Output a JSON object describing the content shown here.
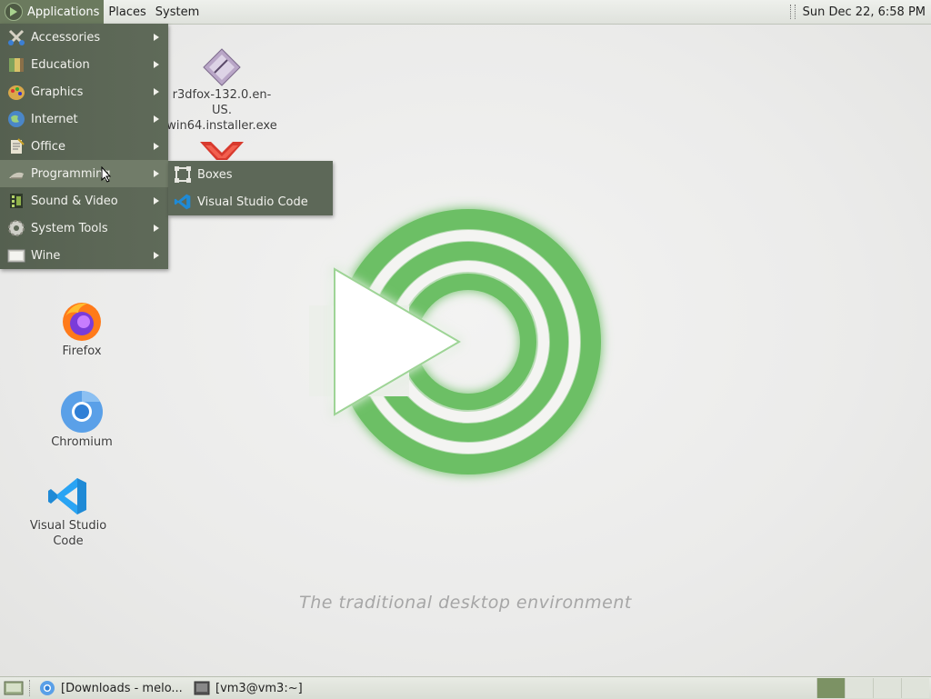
{
  "top_panel": {
    "menus": [
      "Applications",
      "Places",
      "System"
    ],
    "clock": "Sun Dec 22,  6:58 PM"
  },
  "apps_menu": {
    "items": [
      {
        "label": "Accessories",
        "icon": "accessories-icon"
      },
      {
        "label": "Education",
        "icon": "education-icon"
      },
      {
        "label": "Graphics",
        "icon": "graphics-icon"
      },
      {
        "label": "Internet",
        "icon": "internet-icon"
      },
      {
        "label": "Office",
        "icon": "office-icon"
      },
      {
        "label": "Programming",
        "icon": "programming-icon",
        "selected": true
      },
      {
        "label": "Sound & Video",
        "icon": "sound-video-icon"
      },
      {
        "label": "System Tools",
        "icon": "system-tools-icon"
      },
      {
        "label": "Wine",
        "icon": "wine-icon"
      }
    ]
  },
  "programming_submenu": {
    "items": [
      {
        "label": "Boxes",
        "icon": "boxes-icon"
      },
      {
        "label": "Visual Studio Code",
        "icon": "vscode-icon"
      }
    ]
  },
  "desktop": {
    "icons": [
      {
        "label_line1": "r3dfox-132.0.en-US.",
        "label_line2": "win64.installer.exe",
        "icon": "installer-icon"
      },
      {
        "label": "Firefox",
        "icon": "firefox-icon"
      },
      {
        "label": "Chromium",
        "icon": "chromium-icon"
      },
      {
        "label": "Visual Studio Code",
        "icon": "vscode-icon"
      }
    ],
    "tagline": "The traditional desktop environment"
  },
  "bottom_panel": {
    "tasks": [
      "[Downloads - melo...",
      "[vm3@vm3:~]"
    ],
    "workspaces": 4,
    "active_workspace": 1
  },
  "colors": {
    "menu_bg": "#5c6756",
    "menu_selected": "#717c69",
    "logo_green": "#6cbf65"
  }
}
